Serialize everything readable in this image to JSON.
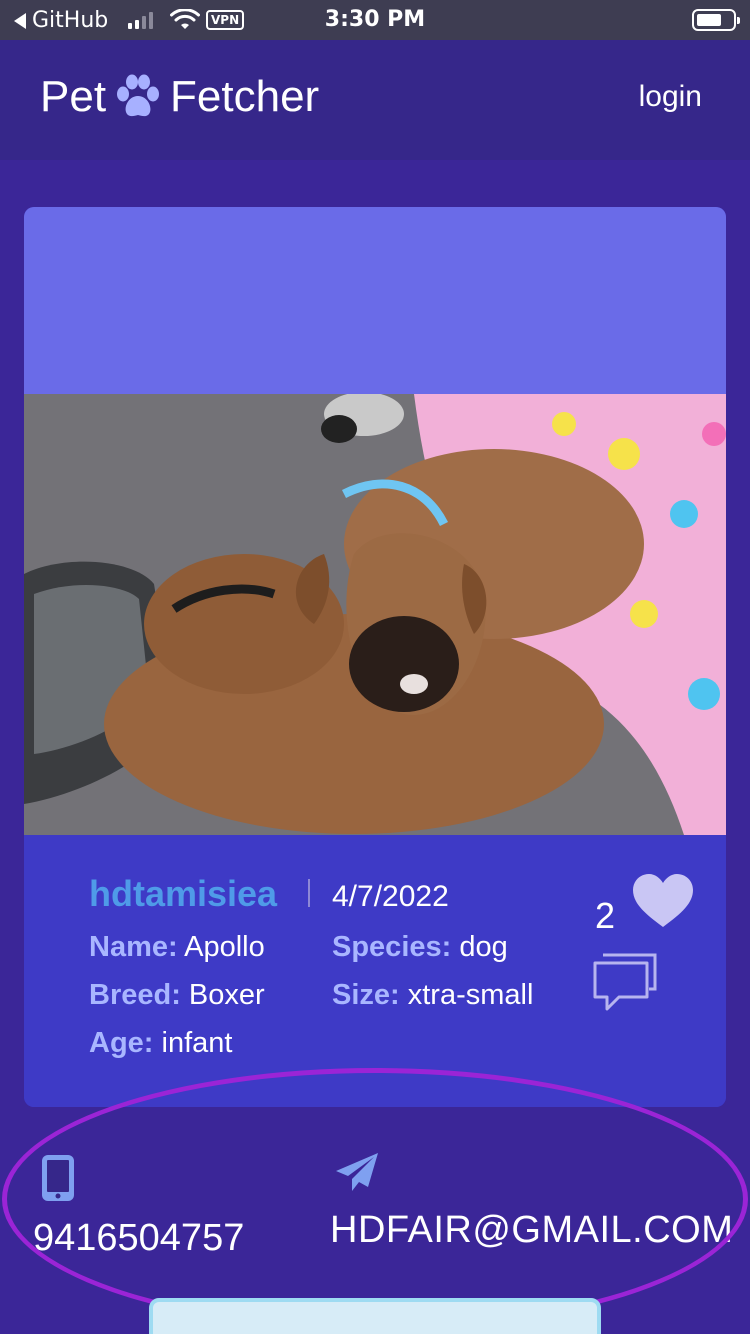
{
  "status_bar": {
    "back_label": "GitHub",
    "vpn_label": "VPN",
    "time": "3:30 PM",
    "signal_bars": 2
  },
  "header": {
    "logo_left": "Pet",
    "logo_right": "Fetcher",
    "login_label": "login",
    "logo_icon": "paw-icon"
  },
  "post": {
    "username": "hdtamisiea",
    "date": "4/7/2022",
    "name_label": "Name:",
    "name_value": "Apollo",
    "species_label": "Species:",
    "species_value": "dog",
    "breed_label": "Breed:",
    "breed_value": "Boxer",
    "size_label": "Size:",
    "size_value": "xtra-small",
    "age_label": "Age:",
    "age_value": "infant",
    "likes_count": "2",
    "like_icon": "heart-icon",
    "comment_icon": "comment-icon"
  },
  "contact": {
    "phone": "9416504757",
    "email": "HDFAIR@GMAIL.COM",
    "phone_icon": "phone-icon",
    "email_icon": "send-icon"
  },
  "colors": {
    "page_bg": "#3b2698",
    "card_top": "#6a6be8",
    "card_info": "#3e3ac6",
    "username": "#4f9be8",
    "field_label": "#a9b6ff",
    "highlight": "#9b24d6"
  }
}
